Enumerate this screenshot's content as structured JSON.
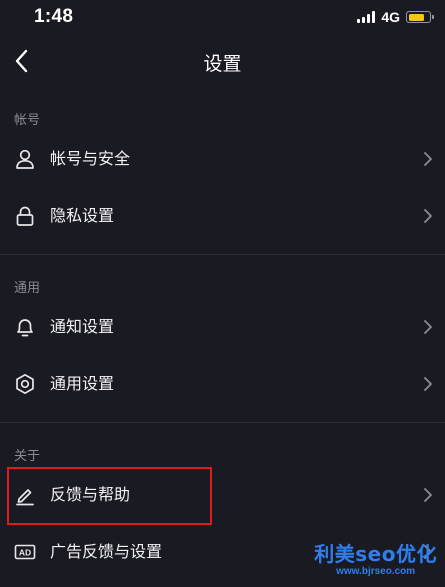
{
  "status_bar": {
    "time": "1:48",
    "network": "4G",
    "battery_level": 0.8,
    "battery_color": "#f5c518"
  },
  "nav": {
    "back_icon": "chevron-left-icon",
    "title": "设置"
  },
  "sections": [
    {
      "header": "帐号",
      "items": [
        {
          "label": "帐号与安全",
          "icon": "person-icon"
        },
        {
          "label": "隐私设置",
          "icon": "lock-icon"
        }
      ]
    },
    {
      "header": "通用",
      "items": [
        {
          "label": "通知设置",
          "icon": "bell-icon"
        },
        {
          "label": "通用设置",
          "icon": "gear-icon"
        }
      ]
    },
    {
      "header": "关于",
      "items": [
        {
          "label": "反馈与帮助",
          "icon": "pencil-icon",
          "highlighted": true
        },
        {
          "label": "广告反馈与设置",
          "icon": "ad-icon"
        }
      ]
    }
  ],
  "annotation": {
    "highlight_color": "#e0191c"
  },
  "watermark": {
    "main": "利美seo优化",
    "sub": "www.bjrseo.com"
  }
}
